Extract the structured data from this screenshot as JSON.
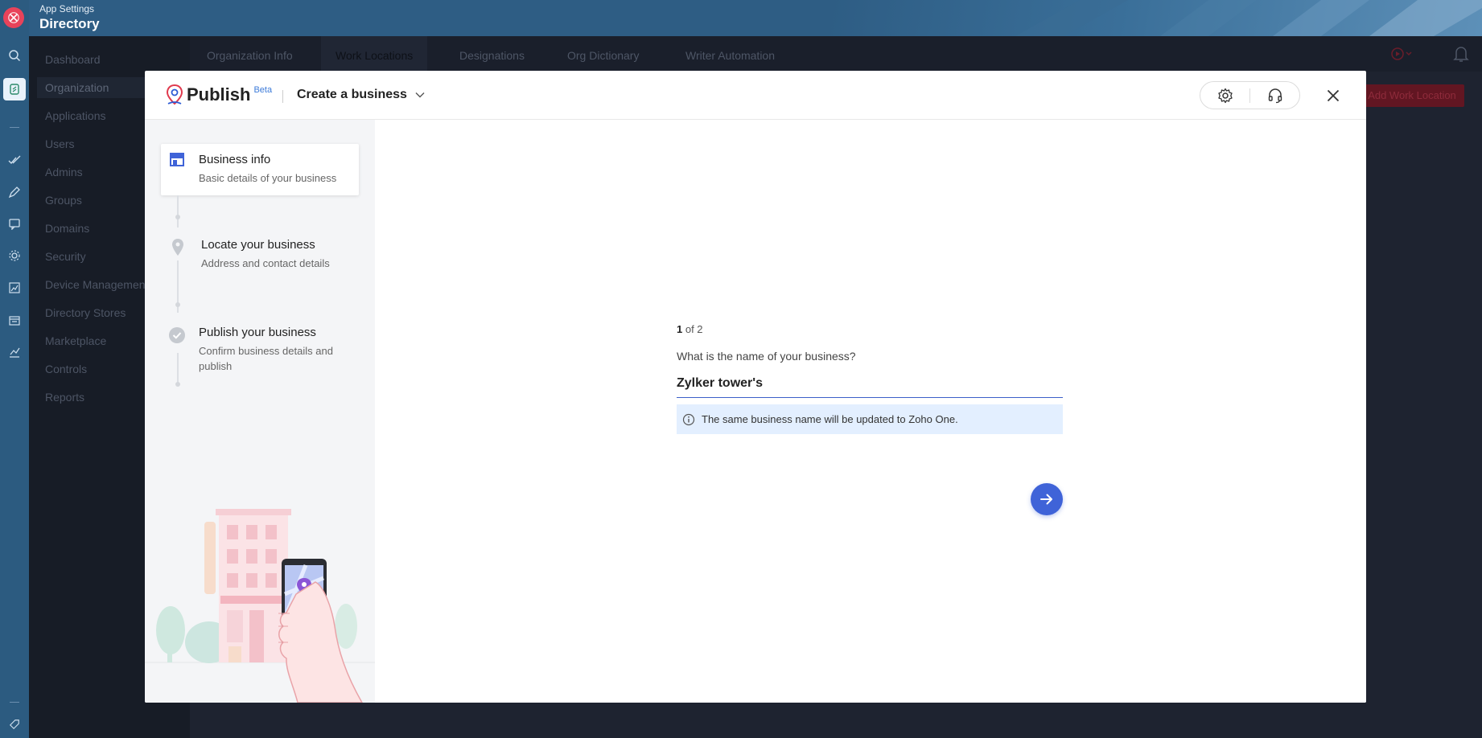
{
  "app": {
    "subtitle": "App Settings",
    "title": "Directory"
  },
  "sidebar": {
    "items": [
      {
        "label": "Dashboard"
      },
      {
        "label": "Organization"
      },
      {
        "label": "Applications"
      },
      {
        "label": "Users"
      },
      {
        "label": "Admins"
      },
      {
        "label": "Groups"
      },
      {
        "label": "Domains"
      },
      {
        "label": "Security"
      },
      {
        "label": "Device Management"
      },
      {
        "label": "Directory Stores"
      },
      {
        "label": "Marketplace"
      },
      {
        "label": "Controls"
      },
      {
        "label": "Reports"
      }
    ]
  },
  "tabs": [
    {
      "label": "Organization Info"
    },
    {
      "label": "Work Locations"
    },
    {
      "label": "Designations"
    },
    {
      "label": "Org Dictionary"
    },
    {
      "label": "Writer Automation"
    }
  ],
  "background_action": {
    "label": "Add Work Location"
  },
  "modal": {
    "brand": "Publish",
    "beta": "Beta",
    "business_selector": "Create a business",
    "steps": [
      {
        "title": "Business info",
        "description": "Basic details of your business"
      },
      {
        "title": "Locate your business",
        "description": "Address and contact details"
      },
      {
        "title": "Publish your business",
        "description": "Confirm business details and publish"
      }
    ],
    "form": {
      "step_current": "1",
      "step_total_text": " of 2",
      "question": "What is the name of your business?",
      "business_name": "Zylker tower's",
      "info": "The same business name will be updated to Zoho One."
    }
  },
  "colors": {
    "accent": "#3f63d8",
    "rail": "#2c5b80",
    "close_red": "#e8435a",
    "info_bg": "#e3efff"
  }
}
